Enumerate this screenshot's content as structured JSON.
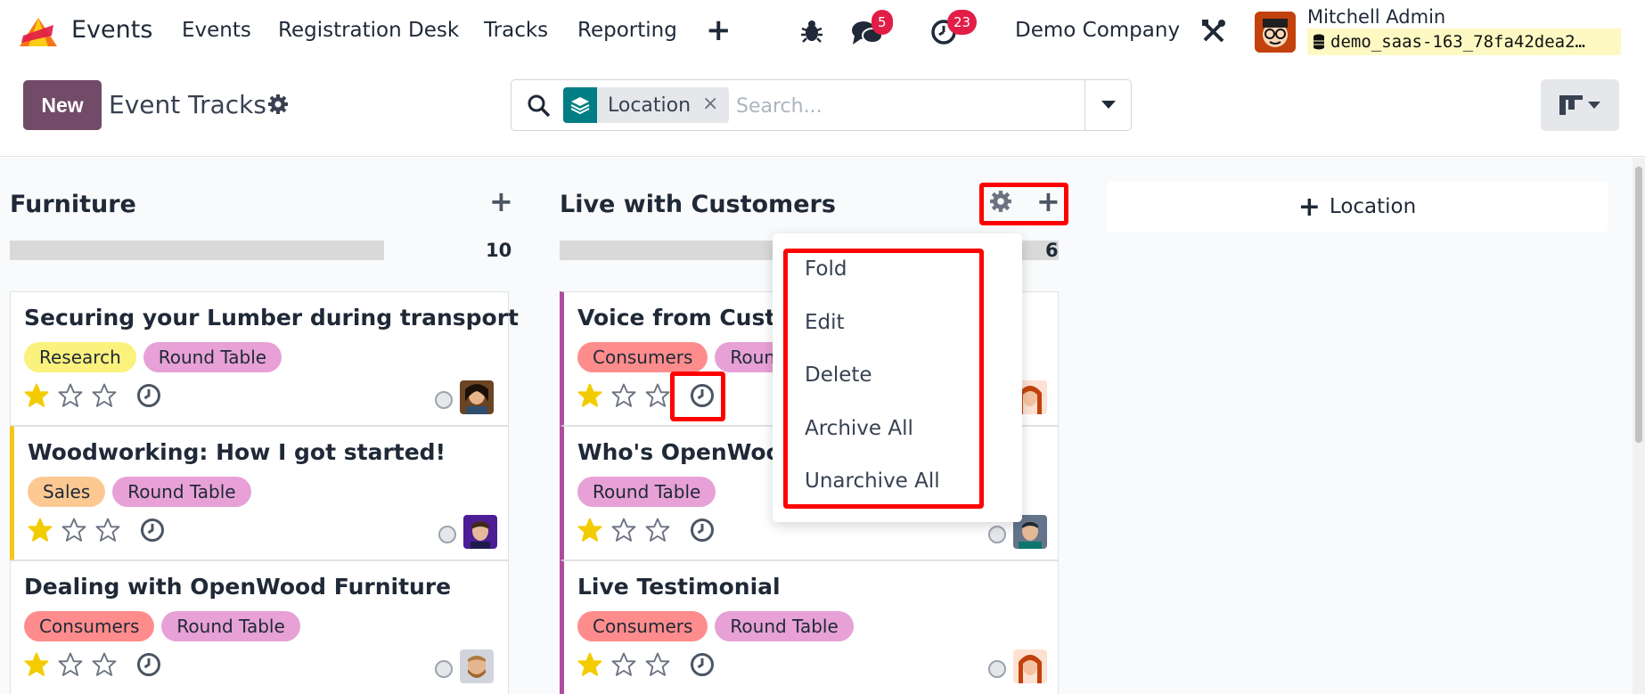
{
  "app": {
    "name": "Events",
    "menu": [
      "Events",
      "Registration Desk",
      "Tracks",
      "Reporting"
    ],
    "messages_count": "5",
    "activities_count": "23",
    "company": "Demo Company",
    "user_name": "Mitchell Admin",
    "database": "demo_saas-163_78fa42dea2…"
  },
  "control": {
    "new_label": "New",
    "title": "Event Tracks",
    "facet_label": "Location",
    "facet_remove": "×",
    "search_placeholder": "Search..."
  },
  "columns": [
    {
      "title": "Furniture",
      "count": "10",
      "progress": 0.77,
      "cards": [
        {
          "title": "Securing your Lumber during transport",
          "tags": [
            "Research",
            "Round Table"
          ],
          "stars": 1
        },
        {
          "title": "Woodworking: How I got started!",
          "tags": [
            "Sales",
            "Round Table"
          ],
          "stars": 1
        },
        {
          "title": "Dealing with OpenWood Furniture",
          "tags": [
            "Consumers",
            "Round Table"
          ],
          "stars": 1
        }
      ]
    },
    {
      "title": "Live with Customers",
      "count": "6",
      "cards": [
        {
          "title": "Voice from Custon",
          "tags": [
            "Consumers",
            "Round"
          ],
          "stars": 1
        },
        {
          "title": "Who's OpenWood",
          "tags": [
            "Round Table"
          ],
          "stars": 1
        },
        {
          "title": "Live Testimonial",
          "tags": [
            "Consumers",
            "Round Table"
          ],
          "stars": 1
        }
      ]
    }
  ],
  "add_column_label": "Location",
  "column_menu": [
    "Fold",
    "Edit",
    "Delete",
    "Archive All",
    "Unarchive All"
  ],
  "colors": {
    "brand": "#714b67",
    "research": "#fbf17d",
    "round_table": "#e7a1d6",
    "sales": "#fdc993",
    "consumers": "#ff8c8c",
    "yellow_accent": "#f5c518",
    "pink_accent": "#b04c9e",
    "star": "#f3cc00",
    "highlight": "#ff0000"
  }
}
